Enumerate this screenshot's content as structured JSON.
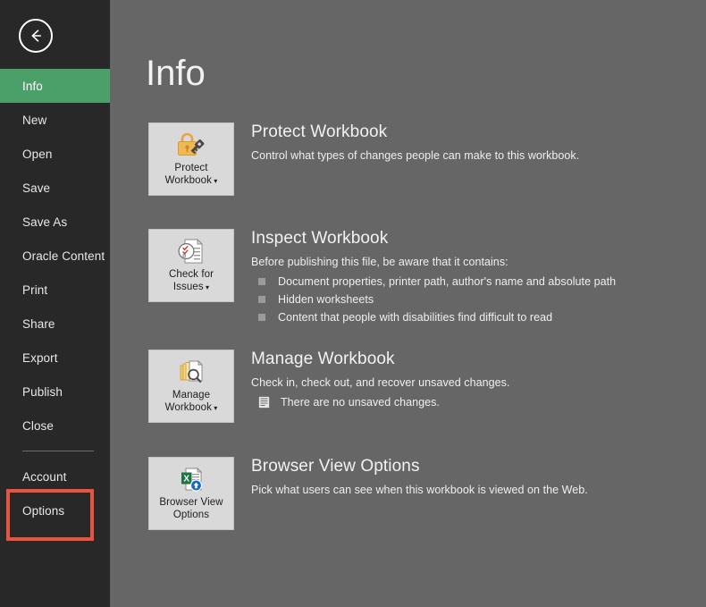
{
  "sidebar": {
    "back_button": {
      "icon": "back-arrow-icon"
    },
    "items": [
      {
        "label": "Info",
        "active": true
      },
      {
        "label": "New",
        "active": false
      },
      {
        "label": "Open",
        "active": false
      },
      {
        "label": "Save",
        "active": false
      },
      {
        "label": "Save As",
        "active": false
      },
      {
        "label": "Oracle Content",
        "active": false
      },
      {
        "label": "Print",
        "active": false
      },
      {
        "label": "Share",
        "active": false
      },
      {
        "label": "Export",
        "active": false
      },
      {
        "label": "Publish",
        "active": false
      },
      {
        "label": "Close",
        "active": false
      }
    ],
    "bottom_items": [
      {
        "label": "Account",
        "highlighted": false
      },
      {
        "label": "Options",
        "highlighted": true
      }
    ],
    "highlight_color": "#e8543f",
    "active_color": "#4ba06a",
    "background_color": "#282828"
  },
  "main": {
    "title": "Info",
    "background_color": "#666666",
    "sections": [
      {
        "tile_label_line1": "Protect",
        "tile_label_line2": "Workbook",
        "tile_has_caret": true,
        "tile_icon": "padlock-key-icon",
        "heading": "Protect Workbook",
        "description": "Control what types of changes people can make to this workbook.",
        "bullets": [],
        "note": null
      },
      {
        "tile_label_line1": "Check for",
        "tile_label_line2": "Issues",
        "tile_has_caret": true,
        "tile_icon": "document-inspect-icon",
        "heading": "Inspect Workbook",
        "description": "Before publishing this file, be aware that it contains:",
        "bullets": [
          "Document properties, printer path, author's name and absolute path",
          "Hidden worksheets",
          "Content that people with disabilities find difficult to read"
        ],
        "note": null
      },
      {
        "tile_label_line1": "Manage",
        "tile_label_line2": "Workbook",
        "tile_has_caret": true,
        "tile_icon": "document-stack-magnifier-icon",
        "heading": "Manage Workbook",
        "description": "Check in, check out, and recover unsaved changes.",
        "bullets": [],
        "note": "There are no unsaved changes."
      },
      {
        "tile_label_line1": "Browser View",
        "tile_label_line2": "Options",
        "tile_has_caret": false,
        "tile_icon": "excel-web-upload-icon",
        "heading": "Browser View Options",
        "description": "Pick what users can see when this workbook is viewed on the Web.",
        "bullets": [],
        "note": null
      }
    ]
  }
}
